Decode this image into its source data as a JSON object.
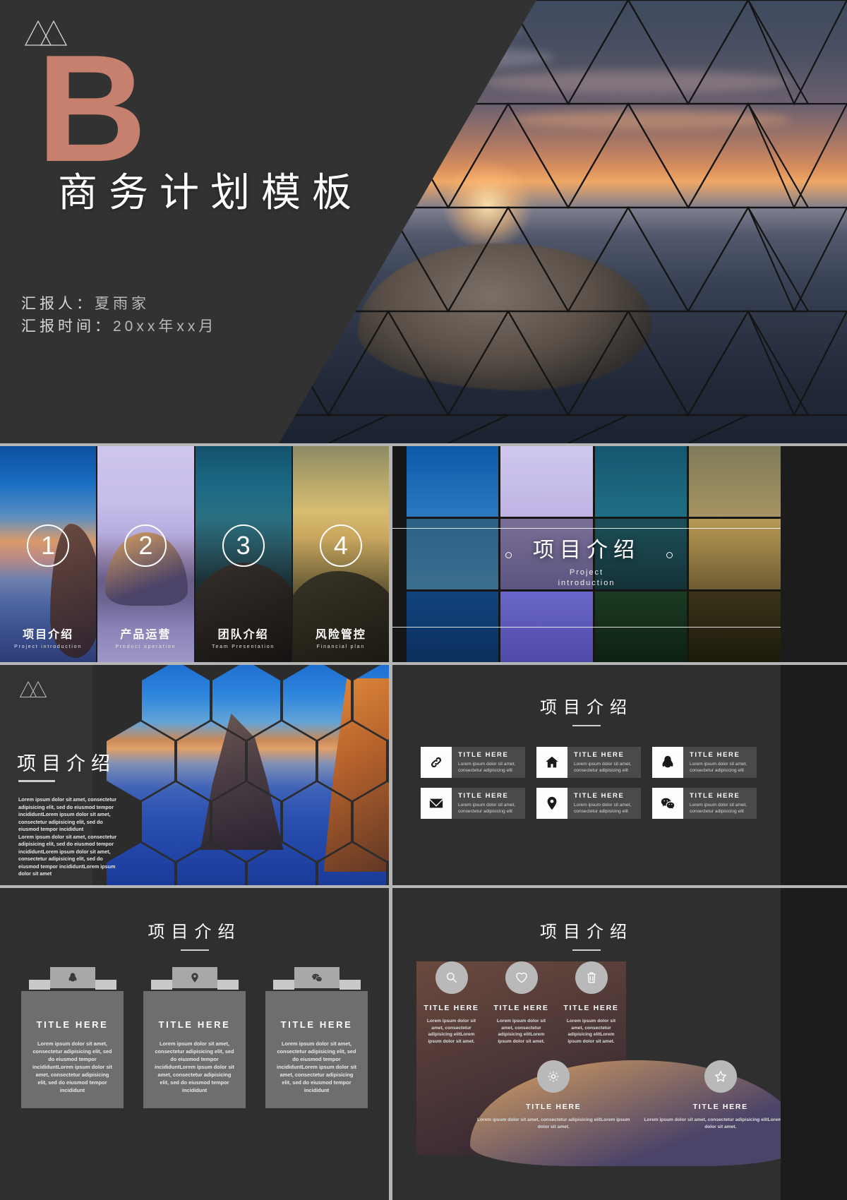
{
  "cover": {
    "logo_icon": "mountain-logo-icon",
    "big_letter": "B",
    "title": "商务计划模板",
    "presenter_label": "汇报人：",
    "presenter_value": "夏雨家",
    "date_label": "汇报时间：",
    "date_value": "20xx年xx月",
    "accent_color": "#c7806d"
  },
  "agenda": {
    "items": [
      {
        "num": "1",
        "cn": "项目介绍",
        "en": "Project introduction"
      },
      {
        "num": "2",
        "cn": "产品运营",
        "en": "Product operation"
      },
      {
        "num": "3",
        "cn": "团队介绍",
        "en": "Team Presentation"
      },
      {
        "num": "4",
        "cn": "风险管控",
        "en": "Financial plan"
      }
    ]
  },
  "section": {
    "title_cn": "项目介绍",
    "title_en_line1": "Project",
    "title_en_line2": "introduction"
  },
  "hex_slide": {
    "logo_icon": "mountain-logo-icon",
    "title": "项目介绍",
    "paragraph1": "Lorem ipsum dolor sit amet, consectetur adipisicing elit, sed do eiusmod tempor incididuntLorem ipsum dolor sit amet, consectetur adipisicing elit, sed do eiusmod tempor incididunt",
    "paragraph2": "Lorem ipsum dolor sit amet, consectetur adipisicing elit, sed do eiusmod tempor incididuntLorem ipsum dolor sit amet, consectetur adipisicing elit, sed do eiusmod tempor incididuntLorem ipsum dolor sit amet"
  },
  "icon_slide": {
    "title": "项目介绍",
    "cards": [
      {
        "icon": "link-icon",
        "title": "TITLE HERE",
        "desc": "Lorem ipsum dolor sit amet, consectetur adipisicing elit"
      },
      {
        "icon": "home-icon",
        "title": "TITLE HERE",
        "desc": "Lorem ipsum dolor sit amet, consectetur adipisicing elit"
      },
      {
        "icon": "qq-icon",
        "title": "TITLE HERE",
        "desc": "Lorem ipsum dolor sit amet, consectetur adipisicing elit"
      },
      {
        "icon": "envelope-icon",
        "title": "TITLE HERE",
        "desc": "Lorem ipsum dolor sit amet, consectetur adipisicing elit"
      },
      {
        "icon": "location-pin-icon",
        "title": "TITLE HERE",
        "desc": "Lorem ipsum dolor sit amet, consectetur adipisicing elit"
      },
      {
        "icon": "wechat-icon",
        "title": "TITLE HERE",
        "desc": "Lorem ipsum dolor sit amet, consectetur adipisicing elit"
      }
    ]
  },
  "clipboard_slide": {
    "title": "项目介绍",
    "cards": [
      {
        "icon": "qq-icon",
        "title": "TITLE HERE",
        "desc": "Lorem ipsum dolor sit amet, consectetur adipisicing elit, sed do eiusmod tempor incididuntLorem ipsum dolor sit amet, consectetur adipisicing elit, sed do eiusmod tempor incididunt"
      },
      {
        "icon": "location-pin-icon",
        "title": "TITLE HERE",
        "desc": "Lorem ipsum dolor sit amet, consectetur adipisicing elit, sed do eiusmod tempor incididuntLorem ipsum dolor sit amet, consectetur adipisicing elit, sed do eiusmod tempor incididunt"
      },
      {
        "icon": "wechat-icon",
        "title": "TITLE HERE",
        "desc": "Lorem ipsum dolor sit amet, consectetur adipisicing elit, sed do eiusmod tempor incididuntLorem ipsum dolor sit amet, consectetur adipisicing elit, sed do eiusmod tempor incididunt"
      }
    ]
  },
  "circle_slide": {
    "title": "项目介绍",
    "row1": [
      {
        "icon": "search-icon",
        "title": "TITLE HERE",
        "desc": "Lorem ipsum dolor sit amet, consectetur adipisicing elitLorem ipsum dolor sit amet."
      },
      {
        "icon": "heart-icon",
        "title": "TITLE HERE",
        "desc": "Lorem ipsum dolor sit amet, consectetur adipisicing elitLorem ipsum dolor sit amet."
      },
      {
        "icon": "trash-icon",
        "title": "TITLE HERE",
        "desc": "Lorem ipsum dolor sit amet, consectetur adipisicing elitLorem ipsum dolor sit amet."
      }
    ],
    "row2": [
      {
        "icon": "gear-icon",
        "title": "TITLE HERE",
        "desc": "Lorem ipsum dolor sit amet, consectetur adipisicing elitLorem ipsum dolor sit amet."
      },
      {
        "icon": "star-icon",
        "title": "TITLE HERE",
        "desc": "Lorem ipsum dolor sit amet, consectetur adipisicing elitLorem ipsum dolor sit amet."
      }
    ]
  }
}
